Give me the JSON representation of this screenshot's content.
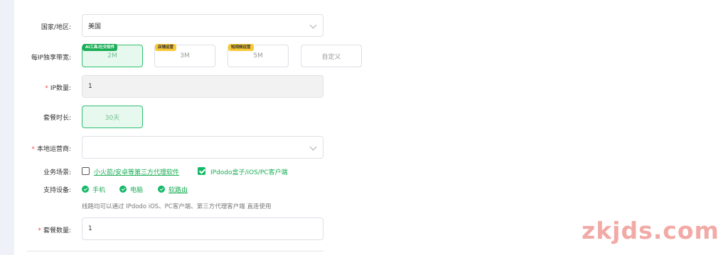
{
  "country": {
    "label": "国家/地区:",
    "value": "美国"
  },
  "bandwidth": {
    "label": "每IP独享带宽:",
    "options": [
      {
        "tag": "AI工具/社交软件",
        "value": "2M",
        "selected": true
      },
      {
        "tag": "店铺运营",
        "value": "3M",
        "selected": false
      },
      {
        "tag": "短视频运营",
        "value": "5M",
        "selected": false
      },
      {
        "tag": "",
        "value": "自定义",
        "selected": false
      }
    ]
  },
  "ip_count": {
    "required": "*",
    "label": "IP数量:",
    "value": "1"
  },
  "duration": {
    "label": "套餐时长:",
    "value": "30天"
  },
  "isp": {
    "required": "*",
    "label": "本地运营商:",
    "value": ""
  },
  "scenario": {
    "label": "业务场景:",
    "options": [
      {
        "text": "小火箭/安卓等第三方代理软件",
        "checked": false
      },
      {
        "text": "IPdodo盒子/iOS/PC客户端",
        "checked": true
      }
    ]
  },
  "devices": {
    "label": "支持设备:",
    "items": [
      "手机",
      "电脑",
      "软路由"
    ]
  },
  "hint": "线路均可以通过 IPdodo iOS、PC客户端、第三方代理客户端 直连使用",
  "quantity": {
    "required": "*",
    "label": "套餐数量:",
    "value": "1"
  },
  "watermark": "zkjds.com",
  "colors": {
    "accent": "#14b866",
    "required": "#f04848",
    "tag_green": "#1aad55",
    "tag_yellow": "#f7c836"
  }
}
